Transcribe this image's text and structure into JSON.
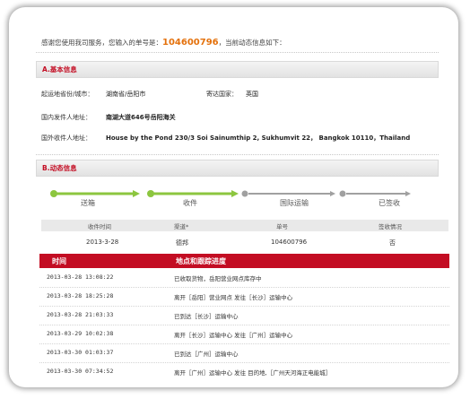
{
  "intro": {
    "prefix": "感谢您使用我司服务，您输入的单号是：",
    "number": "104600796",
    "suffix": "，当前动态信息如下："
  },
  "basic": {
    "title": "A.基本信息",
    "origin_label": "起运地省份/城市：",
    "origin_value": "湖南省/岳阳市",
    "dest_label": "寄达国家：",
    "dest_value": "英国",
    "sender_label": "国内发件人地址：",
    "sender_value": "南湖大道646号岳阳海关",
    "receiver_label": "国外收件人地址：",
    "receiver_value": "House by the Pond 230/3 Soi Sainumthip 2, Sukhumvit 22，  Bangkok 10110，Thailand"
  },
  "dynamic": {
    "title": "B.动态信息",
    "steps": [
      "送箱",
      "收件",
      "国际运输",
      "已签收"
    ],
    "step_active_color": "#8cc63f",
    "step_inactive_color": "#a0a0a0",
    "columns": [
      "收件时间",
      "渠道*",
      "单号",
      "签收情况"
    ],
    "row": [
      "2013-3-28",
      "德邦",
      "104600796",
      "否"
    ]
  },
  "tracking": {
    "headers": [
      "时间",
      "地点和跟踪进度"
    ],
    "rows": [
      {
        "time": "2013-03-28 13:08:22",
        "desc": "已收取货物，岳阳营业网点库存中"
      },
      {
        "time": "2013-03-28 18:25:28",
        "desc": "离开［岳阳］营业网点 发往［长沙］运输中心"
      },
      {
        "time": "2013-03-28 21:03:33",
        "desc": "已到达［长沙］运输中心"
      },
      {
        "time": "2013-03-29 10:02:38",
        "desc": "离开［长沙］运输中心 发往［广州］运输中心"
      },
      {
        "time": "2013-03-30 01:03:37",
        "desc": "已到达［广州］运输中心"
      },
      {
        "time": "2013-03-30 07:34:52",
        "desc": "离开［广州］运输中心 发往 目的地,［广州天河海正电能城］"
      }
    ]
  }
}
